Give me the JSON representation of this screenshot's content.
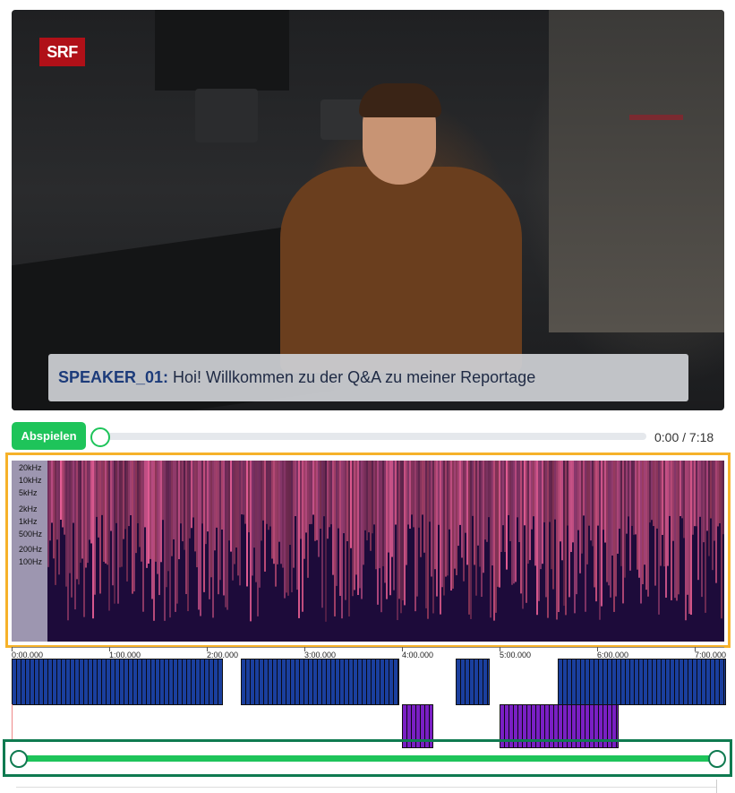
{
  "video": {
    "logo": "SRF",
    "subtitle_speaker": "SPEAKER_01:",
    "subtitle_text": " Hoi! Willkommen zu der Q&A zu meiner Reportage"
  },
  "player": {
    "play_label": "Abspielen",
    "time": "0:00 / 7:18",
    "progress": 0
  },
  "spectrogram": {
    "freq_labels": [
      "20kHz",
      "10kHz",
      "5kHz",
      "2kHz",
      "1kHz",
      "500Hz",
      "200Hz",
      "100Hz"
    ]
  },
  "timeline": {
    "labels": [
      "0:00.000",
      "1:00.000",
      "2:00.000",
      "3:00.000",
      "4:00.000",
      "5:00.000",
      "6:00.000",
      "7:00.000"
    ]
  },
  "speaker_segments": {
    "speaker_a": [
      [
        0,
        2.15
      ],
      [
        2.35,
        3.95
      ],
      [
        4.55,
        4.88
      ],
      [
        5.6,
        7.3
      ]
    ],
    "speaker_b": [
      [
        4.0,
        4.3
      ],
      [
        5.0,
        6.2
      ]
    ]
  },
  "range": {
    "start": 0,
    "end": 1
  },
  "colors": {
    "accent_green": "#1ec45a",
    "speaker_a": "#1a3f9e",
    "speaker_b": "#7a1fc4",
    "spectrogram_frame": "#f6b22a",
    "range_frame": "#0f7a50"
  }
}
